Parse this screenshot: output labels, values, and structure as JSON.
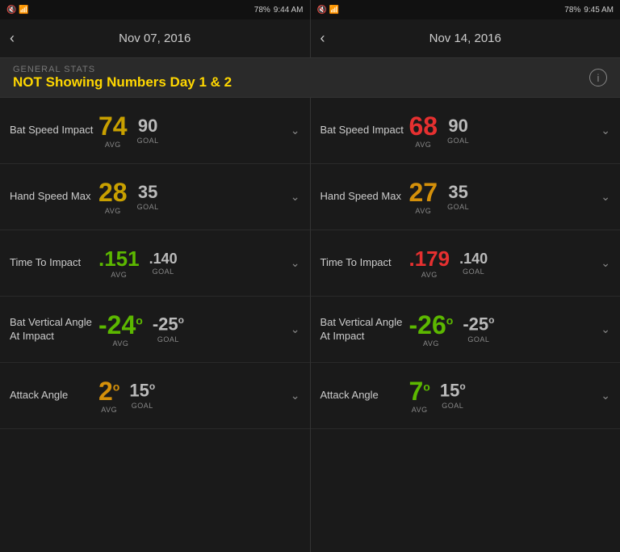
{
  "statusBars": [
    {
      "icons": "🔇 📶 78%",
      "time": "9:44 AM"
    },
    {
      "icons": "🔇 📶 78%",
      "time": "9:45 AM"
    }
  ],
  "navHeaders": [
    {
      "date": "Nov 07, 2016"
    },
    {
      "date": "Nov 14, 2016"
    }
  ],
  "banner": {
    "label": "GENERAL STATS",
    "title": "NOT Showing Numbers Day 1 & 2",
    "infoLabel": "i"
  },
  "panels": [
    {
      "id": "left",
      "stats": [
        {
          "label": "Bat Speed Impact",
          "avg": "74",
          "avgColor": "yellow",
          "goal": "90",
          "avgLabel": "AVG",
          "goalLabel": "GOAL",
          "superscript": ""
        },
        {
          "label": "Hand Speed Max",
          "avg": "28",
          "avgColor": "orange",
          "goal": "35",
          "avgLabel": "AVG",
          "goalLabel": "GOAL",
          "superscript": ""
        },
        {
          "label": "Time To Impact",
          "avg": ".151",
          "avgColor": "green",
          "goal": ".140",
          "avgLabel": "AVG",
          "goalLabel": "GOAL",
          "superscript": ""
        },
        {
          "label": "Bat Vertical Angle At Impact",
          "avg": "-24",
          "avgColor": "green",
          "goal": "-25",
          "avgLabel": "AVG",
          "goalLabel": "GOAL",
          "superscript": "o"
        },
        {
          "label": "Attack Angle",
          "avg": "2",
          "avgColor": "orange",
          "goal": "15",
          "avgLabel": "AVG",
          "goalLabel": "GOAL",
          "superscript": "o"
        }
      ]
    },
    {
      "id": "right",
      "stats": [
        {
          "label": "Bat Speed Impact",
          "avg": "68",
          "avgColor": "red",
          "goal": "90",
          "avgLabel": "AVG",
          "goalLabel": "GOAL",
          "superscript": ""
        },
        {
          "label": "Hand Speed Max",
          "avg": "27",
          "avgColor": "orange",
          "goal": "35",
          "avgLabel": "AVG",
          "goalLabel": "GOAL",
          "superscript": ""
        },
        {
          "label": "Time To Impact",
          "avg": ".179",
          "avgColor": "red",
          "goal": ".140",
          "avgLabel": "AVG",
          "goalLabel": "GOAL",
          "superscript": ""
        },
        {
          "label": "Bat Vertical Angle At Impact",
          "avg": "-26",
          "avgColor": "green",
          "goal": "-25",
          "avgLabel": "AVG",
          "goalLabel": "GOAL",
          "superscript": "o"
        },
        {
          "label": "Attack Angle",
          "avg": "7",
          "avgColor": "green",
          "goal": "15",
          "avgLabel": "AVG",
          "goalLabel": "GOAL",
          "superscript": "o"
        }
      ]
    }
  ]
}
